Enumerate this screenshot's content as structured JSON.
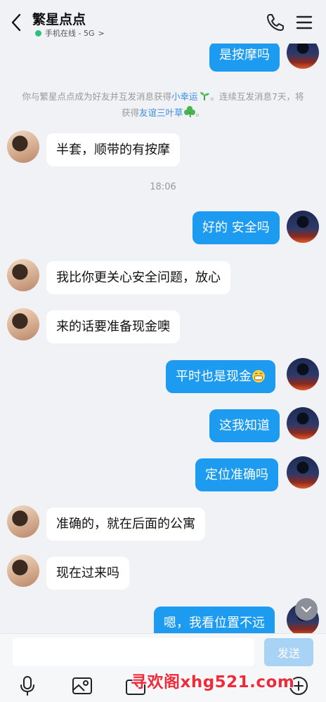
{
  "header": {
    "title": "繁星点点",
    "presence": "手机在线 - 5G",
    "presence_arrow": ">"
  },
  "system": {
    "part1": "你与繁星点点成为好友并互发消息获得",
    "lucky": "小幸运",
    "part2": "。连续互发消息7天，将获得",
    "clover": "友谊三叶草",
    "part3": "。"
  },
  "timestamp": "18:06",
  "messages": {
    "m0": "是按摩吗",
    "m1": "半套，顺带的有按摩",
    "m2": "好的 安全吗",
    "m3": "我比你更关心安全问题，放心",
    "m4": "来的话要准备现金噢",
    "m5": "平时也是现金",
    "m6": "这我知道",
    "m7": "定位准确吗",
    "m8": "准确的，就在后面的公寓",
    "m9": "现在过来吗",
    "m10": "嗯，我看位置不远"
  },
  "input": {
    "placeholder": "",
    "send_label": "发送"
  },
  "watermark": "寻欢阁xhg521.com",
  "colors": {
    "outgoing_bubble": "#1c9bf0",
    "incoming_bubble": "#ffffff",
    "online_dot": "#2ac17a",
    "link": "#3a8ee6",
    "watermark": "#f02a3a"
  },
  "icons": {
    "back": "chevron-left-icon",
    "phone": "phone-icon",
    "menu": "menu-icon",
    "voice": "microphone-icon",
    "image": "image-icon",
    "camera": "camera-icon",
    "plus": "plus-icon",
    "scroll": "chevron-down-icon"
  }
}
